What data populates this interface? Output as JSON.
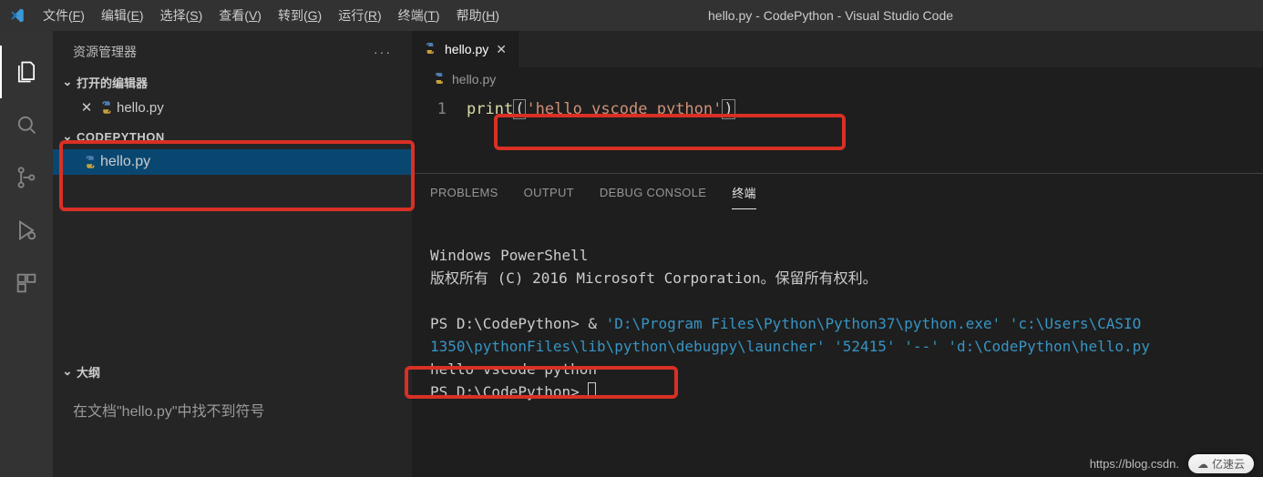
{
  "title_bar": {
    "window_title": "hello.py - CodePython - Visual Studio Code",
    "menu": [
      {
        "label": "文件",
        "accel": "F"
      },
      {
        "label": "编辑",
        "accel": "E"
      },
      {
        "label": "选择",
        "accel": "S"
      },
      {
        "label": "查看",
        "accel": "V"
      },
      {
        "label": "转到",
        "accel": "G"
      },
      {
        "label": "运行",
        "accel": "R"
      },
      {
        "label": "终端",
        "accel": "T"
      },
      {
        "label": "帮助",
        "accel": "H"
      }
    ]
  },
  "sidebar": {
    "title": "资源管理器",
    "open_editors_label": "打开的编辑器",
    "open_editors": [
      {
        "name": "hello.py",
        "icon": "python-file-icon"
      }
    ],
    "workspace_label": "CODEPYTHON",
    "workspace_files": [
      {
        "name": "hello.py",
        "icon": "python-file-icon"
      }
    ],
    "outline_label": "大纲",
    "outline_empty_text": "在文档\"hello.py\"中找不到符号"
  },
  "editor": {
    "tab": {
      "name": "hello.py",
      "icon": "python-file-icon"
    },
    "breadcrumb": "hello.py",
    "line_number": "1",
    "code_tokens": {
      "fn": "print",
      "open": "(",
      "str": "'hello vscode python'",
      "close": ")"
    }
  },
  "panel": {
    "tabs": {
      "problems": "PROBLEMS",
      "output": "OUTPUT",
      "debug_console": "DEBUG CONSOLE",
      "terminal": "终端"
    },
    "terminal_lines": {
      "l1": "Windows PowerShell",
      "l2": "版权所有 (C) 2016 Microsoft Corporation。保留所有权利。",
      "l3a": "PS D:\\CodePython> ",
      "l3b": "& ",
      "l3c": "'D:\\Program Files\\Python\\Python37\\python.exe'",
      "l3d": " ",
      "l3e": "'c:\\Users\\CASIO",
      "l4a": "1350\\pythonFiles\\lib\\python\\debugpy\\launcher'",
      "l4b": " ",
      "l4c": "'52415'",
      "l4d": " ",
      "l4e": "'--'",
      "l4f": " ",
      "l4g": "'d:\\CodePython\\hello.py",
      "l5": "hello vscode python",
      "l6": "PS D:\\CodePython> "
    }
  },
  "watermark": {
    "url": "https://blog.csdn.",
    "badge": "亿速云"
  }
}
